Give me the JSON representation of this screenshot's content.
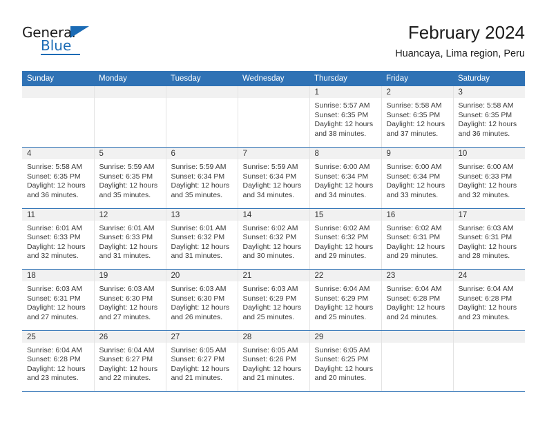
{
  "brand": {
    "name_top": "General",
    "name_bottom": "Blue",
    "accent_color": "#1b6bb5",
    "logo_icon": "triangle-flag-icon"
  },
  "header": {
    "title": "February 2024",
    "subtitle": "Huancaya, Lima region, Peru"
  },
  "theme": {
    "header_blue": "#2f72b5",
    "daynum_band": "#f1f1f1",
    "grid_line": "#e3e3e3",
    "text": "#3a3a3a"
  },
  "calendar": {
    "weekday_headers": [
      "Sunday",
      "Monday",
      "Tuesday",
      "Wednesday",
      "Thursday",
      "Friday",
      "Saturday"
    ],
    "weeks": [
      [
        {
          "day": "",
          "sunrise": "",
          "sunset": "",
          "daylight_line1": "",
          "daylight_line2": ""
        },
        {
          "day": "",
          "sunrise": "",
          "sunset": "",
          "daylight_line1": "",
          "daylight_line2": ""
        },
        {
          "day": "",
          "sunrise": "",
          "sunset": "",
          "daylight_line1": "",
          "daylight_line2": ""
        },
        {
          "day": "",
          "sunrise": "",
          "sunset": "",
          "daylight_line1": "",
          "daylight_line2": ""
        },
        {
          "day": "1",
          "sunrise": "Sunrise: 5:57 AM",
          "sunset": "Sunset: 6:35 PM",
          "daylight_line1": "Daylight: 12 hours",
          "daylight_line2": "and 38 minutes."
        },
        {
          "day": "2",
          "sunrise": "Sunrise: 5:58 AM",
          "sunset": "Sunset: 6:35 PM",
          "daylight_line1": "Daylight: 12 hours",
          "daylight_line2": "and 37 minutes."
        },
        {
          "day": "3",
          "sunrise": "Sunrise: 5:58 AM",
          "sunset": "Sunset: 6:35 PM",
          "daylight_line1": "Daylight: 12 hours",
          "daylight_line2": "and 36 minutes."
        }
      ],
      [
        {
          "day": "4",
          "sunrise": "Sunrise: 5:58 AM",
          "sunset": "Sunset: 6:35 PM",
          "daylight_line1": "Daylight: 12 hours",
          "daylight_line2": "and 36 minutes."
        },
        {
          "day": "5",
          "sunrise": "Sunrise: 5:59 AM",
          "sunset": "Sunset: 6:35 PM",
          "daylight_line1": "Daylight: 12 hours",
          "daylight_line2": "and 35 minutes."
        },
        {
          "day": "6",
          "sunrise": "Sunrise: 5:59 AM",
          "sunset": "Sunset: 6:34 PM",
          "daylight_line1": "Daylight: 12 hours",
          "daylight_line2": "and 35 minutes."
        },
        {
          "day": "7",
          "sunrise": "Sunrise: 5:59 AM",
          "sunset": "Sunset: 6:34 PM",
          "daylight_line1": "Daylight: 12 hours",
          "daylight_line2": "and 34 minutes."
        },
        {
          "day": "8",
          "sunrise": "Sunrise: 6:00 AM",
          "sunset": "Sunset: 6:34 PM",
          "daylight_line1": "Daylight: 12 hours",
          "daylight_line2": "and 34 minutes."
        },
        {
          "day": "9",
          "sunrise": "Sunrise: 6:00 AM",
          "sunset": "Sunset: 6:34 PM",
          "daylight_line1": "Daylight: 12 hours",
          "daylight_line2": "and 33 minutes."
        },
        {
          "day": "10",
          "sunrise": "Sunrise: 6:00 AM",
          "sunset": "Sunset: 6:33 PM",
          "daylight_line1": "Daylight: 12 hours",
          "daylight_line2": "and 32 minutes."
        }
      ],
      [
        {
          "day": "11",
          "sunrise": "Sunrise: 6:01 AM",
          "sunset": "Sunset: 6:33 PM",
          "daylight_line1": "Daylight: 12 hours",
          "daylight_line2": "and 32 minutes."
        },
        {
          "day": "12",
          "sunrise": "Sunrise: 6:01 AM",
          "sunset": "Sunset: 6:33 PM",
          "daylight_line1": "Daylight: 12 hours",
          "daylight_line2": "and 31 minutes."
        },
        {
          "day": "13",
          "sunrise": "Sunrise: 6:01 AM",
          "sunset": "Sunset: 6:32 PM",
          "daylight_line1": "Daylight: 12 hours",
          "daylight_line2": "and 31 minutes."
        },
        {
          "day": "14",
          "sunrise": "Sunrise: 6:02 AM",
          "sunset": "Sunset: 6:32 PM",
          "daylight_line1": "Daylight: 12 hours",
          "daylight_line2": "and 30 minutes."
        },
        {
          "day": "15",
          "sunrise": "Sunrise: 6:02 AM",
          "sunset": "Sunset: 6:32 PM",
          "daylight_line1": "Daylight: 12 hours",
          "daylight_line2": "and 29 minutes."
        },
        {
          "day": "16",
          "sunrise": "Sunrise: 6:02 AM",
          "sunset": "Sunset: 6:31 PM",
          "daylight_line1": "Daylight: 12 hours",
          "daylight_line2": "and 29 minutes."
        },
        {
          "day": "17",
          "sunrise": "Sunrise: 6:03 AM",
          "sunset": "Sunset: 6:31 PM",
          "daylight_line1": "Daylight: 12 hours",
          "daylight_line2": "and 28 minutes."
        }
      ],
      [
        {
          "day": "18",
          "sunrise": "Sunrise: 6:03 AM",
          "sunset": "Sunset: 6:31 PM",
          "daylight_line1": "Daylight: 12 hours",
          "daylight_line2": "and 27 minutes."
        },
        {
          "day": "19",
          "sunrise": "Sunrise: 6:03 AM",
          "sunset": "Sunset: 6:30 PM",
          "daylight_line1": "Daylight: 12 hours",
          "daylight_line2": "and 27 minutes."
        },
        {
          "day": "20",
          "sunrise": "Sunrise: 6:03 AM",
          "sunset": "Sunset: 6:30 PM",
          "daylight_line1": "Daylight: 12 hours",
          "daylight_line2": "and 26 minutes."
        },
        {
          "day": "21",
          "sunrise": "Sunrise: 6:03 AM",
          "sunset": "Sunset: 6:29 PM",
          "daylight_line1": "Daylight: 12 hours",
          "daylight_line2": "and 25 minutes."
        },
        {
          "day": "22",
          "sunrise": "Sunrise: 6:04 AM",
          "sunset": "Sunset: 6:29 PM",
          "daylight_line1": "Daylight: 12 hours",
          "daylight_line2": "and 25 minutes."
        },
        {
          "day": "23",
          "sunrise": "Sunrise: 6:04 AM",
          "sunset": "Sunset: 6:28 PM",
          "daylight_line1": "Daylight: 12 hours",
          "daylight_line2": "and 24 minutes."
        },
        {
          "day": "24",
          "sunrise": "Sunrise: 6:04 AM",
          "sunset": "Sunset: 6:28 PM",
          "daylight_line1": "Daylight: 12 hours",
          "daylight_line2": "and 23 minutes."
        }
      ],
      [
        {
          "day": "25",
          "sunrise": "Sunrise: 6:04 AM",
          "sunset": "Sunset: 6:28 PM",
          "daylight_line1": "Daylight: 12 hours",
          "daylight_line2": "and 23 minutes."
        },
        {
          "day": "26",
          "sunrise": "Sunrise: 6:04 AM",
          "sunset": "Sunset: 6:27 PM",
          "daylight_line1": "Daylight: 12 hours",
          "daylight_line2": "and 22 minutes."
        },
        {
          "day": "27",
          "sunrise": "Sunrise: 6:05 AM",
          "sunset": "Sunset: 6:27 PM",
          "daylight_line1": "Daylight: 12 hours",
          "daylight_line2": "and 21 minutes."
        },
        {
          "day": "28",
          "sunrise": "Sunrise: 6:05 AM",
          "sunset": "Sunset: 6:26 PM",
          "daylight_line1": "Daylight: 12 hours",
          "daylight_line2": "and 21 minutes."
        },
        {
          "day": "29",
          "sunrise": "Sunrise: 6:05 AM",
          "sunset": "Sunset: 6:25 PM",
          "daylight_line1": "Daylight: 12 hours",
          "daylight_line2": "and 20 minutes."
        },
        {
          "day": "",
          "sunrise": "",
          "sunset": "",
          "daylight_line1": "",
          "daylight_line2": ""
        },
        {
          "day": "",
          "sunrise": "",
          "sunset": "",
          "daylight_line1": "",
          "daylight_line2": ""
        }
      ]
    ]
  }
}
